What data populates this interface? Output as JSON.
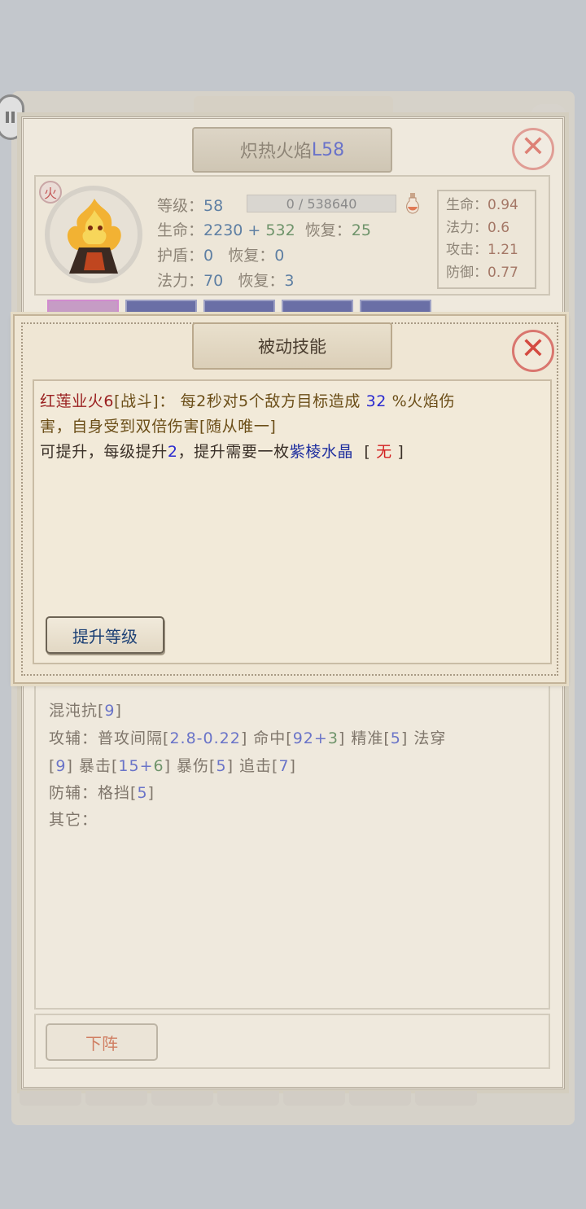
{
  "unit_panel": {
    "title": "炽热火焰",
    "title_level": "L58",
    "element_badge": "火",
    "level_label": "等级：",
    "level_value": "58",
    "exp_text": "0 / 538640",
    "hp_label": "生命：",
    "hp_base": "2230",
    "hp_plus": "+",
    "hp_bonus": "532",
    "hp_regen_label": "恢复：",
    "hp_regen": "25",
    "shield_label": "护盾：",
    "shield_value": "0",
    "shield_regen_label": "恢复：",
    "shield_regen": "0",
    "mana_label": "法力：",
    "mana_value": "70",
    "mana_regen_label": "恢复：",
    "mana_regen": "3",
    "ratios": [
      {
        "label": "生命：",
        "value": "0.94"
      },
      {
        "label": "法力：",
        "value": "0.6"
      },
      {
        "label": "攻击：",
        "value": "1.21"
      },
      {
        "label": "防御：",
        "value": "0.77"
      }
    ],
    "icons": {
      "portrait": "fire-elemental-portrait",
      "potion": "potion-icon",
      "close": "close-icon"
    }
  },
  "details": {
    "line_chaos_label": "混沌抗[",
    "line_chaos_value": "9",
    "line_chaos_end": "]",
    "attack_aux_label": "攻辅：",
    "atk_interval_label": "普攻间隔[",
    "atk_interval_value": "2.8-0.22",
    "hit_label": "] 命中[",
    "hit_value": "92",
    "hit_plus": "+",
    "hit_bonus": "3",
    "precise_label": "] 精准[",
    "precise_value": "5",
    "magpen_label": "] 法穿",
    "magpen_open": "[",
    "magpen_value": "9",
    "crit_label": "] 暴击[",
    "crit_value": "15",
    "crit_plus": "+",
    "crit_bonus": "6",
    "critdmg_label": "] 暴伤[",
    "critdmg_value": "5",
    "chase_label": "] 追击[",
    "chase_value": "7",
    "chase_end": "]",
    "defense_aux_label": "防辅：",
    "block_label": "格挡[",
    "block_value": "5",
    "block_end": "]",
    "other_label": "其它："
  },
  "footer": {
    "retreat_button": "下阵"
  },
  "popup": {
    "title": "被动技能",
    "skill_name": "红莲业火6",
    "skill_tag": "[战斗]：",
    "desc_part1": "每2秒对5个敌方目标造成",
    "damage_value": "32",
    "desc_part2": "%火焰伤",
    "desc_line2": "害，自身受到双倍伤害[随从唯一]",
    "upgrade_text1": "可提升，每级提升",
    "upgrade_step": "2",
    "upgrade_text2": "，提升需要一枚",
    "item_name": "紫棱水晶",
    "bracket_open": "[",
    "item_status": "无",
    "bracket_close": "]",
    "upgrade_button": "提升等级"
  },
  "colors": {
    "accent_red": "#d44a40",
    "link_blue": "#6a74c8",
    "positive_green": "#6f946b",
    "navy": "#1b3f74"
  }
}
